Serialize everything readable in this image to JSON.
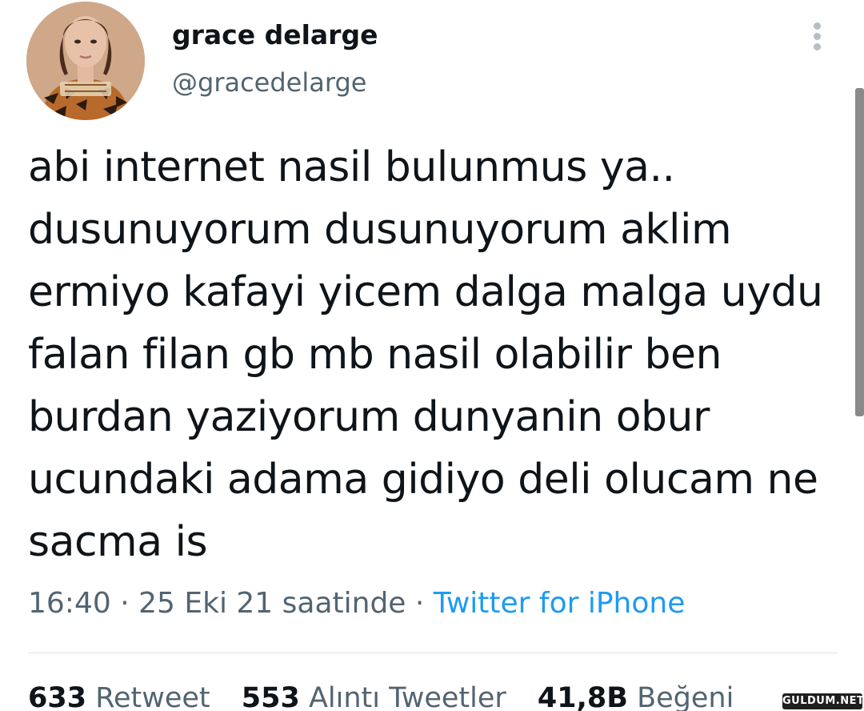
{
  "user": {
    "display_name": "grace delarge",
    "handle": "@gracedelarge"
  },
  "icons": {
    "more": "more-vertical-icon",
    "avatar": "profile-photo"
  },
  "tweet": {
    "text": "abi internet nasil bulunmus ya..\ndusunuyorum dusunuyorum aklim\nermiyo kafayi yicem dalga malga uydu\nfalan filan gb mb nasil olabilir ben\nburdan yaziyorum dunyanin obur\nucundaki adama gidiyo deli olucam ne\nsacma is",
    "time": "16:40",
    "date": "25 Eki 21 saatinde",
    "separator": " · ",
    "source": "Twitter for iPhone"
  },
  "stats": {
    "retweets": {
      "count": "633",
      "label": "Retweet"
    },
    "quotes": {
      "count": "553",
      "label": "Alıntı Tweetler"
    },
    "likes": {
      "count": "41,8B",
      "label": "Beğeni"
    }
  },
  "watermark": "GULDUM.NET",
  "colors": {
    "text": "#0f1419",
    "secondary": "#536471",
    "link": "#1d9bf0",
    "divider": "#dde3e7"
  }
}
